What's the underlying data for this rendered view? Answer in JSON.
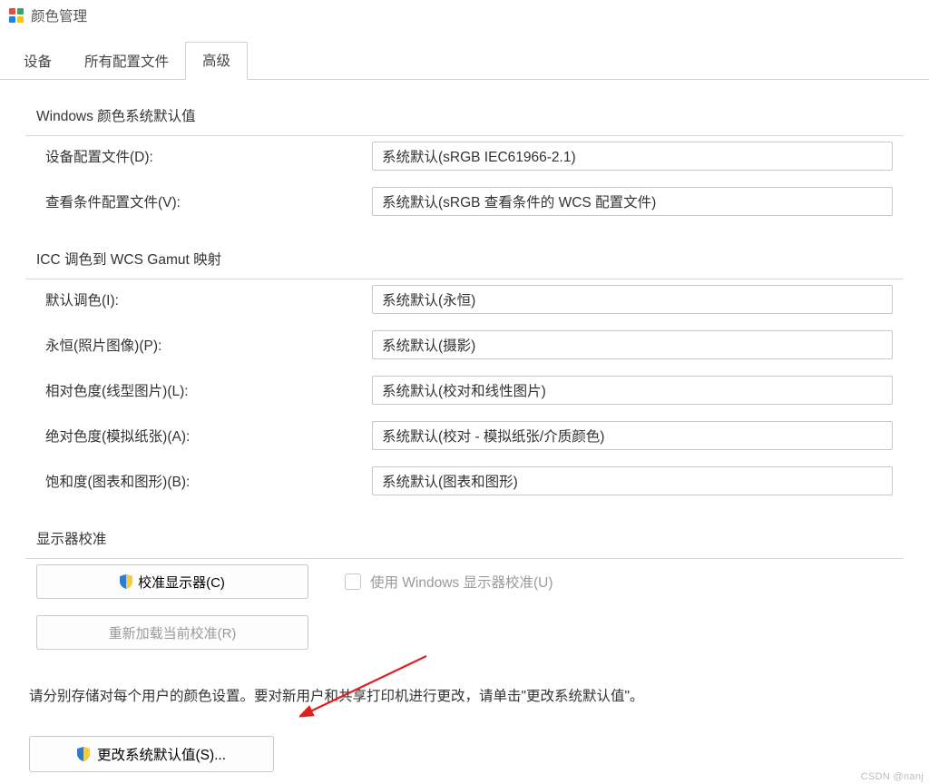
{
  "window": {
    "title": "颜色管理"
  },
  "tabs": {
    "device": "设备",
    "all_profiles": "所有配置文件",
    "advanced": "高级"
  },
  "group_defaults": {
    "legend": "Windows 颜色系统默认值",
    "device_profile_label": "设备配置文件(D):",
    "device_profile_value": "系统默认(sRGB IEC61966-2.1)",
    "viewing_label": "查看条件配置文件(V):",
    "viewing_value": "系统默认(sRGB 查看条件的 WCS 配置文件)"
  },
  "group_icc": {
    "legend": "ICC 调色到 WCS Gamut 映射",
    "default_render_label": "默认调色(I):",
    "default_render_value": "系统默认(永恒)",
    "perpetual_label": "永恒(照片图像)(P):",
    "perpetual_value": "系统默认(摄影)",
    "relative_label": "相对色度(线型图片)(L):",
    "relative_value": "系统默认(校对和线性图片)",
    "absolute_label": "绝对色度(模拟纸张)(A):",
    "absolute_value": "系统默认(校对 - 模拟纸张/介质颜色)",
    "saturation_label": "饱和度(图表和图形)(B):",
    "saturation_value": "系统默认(图表和图形)"
  },
  "group_calib": {
    "legend": "显示器校准",
    "calibrate_btn": "校准显示器(C)",
    "use_windows_calib": "使用 Windows 显示器校准(U)",
    "reload_btn": "重新加载当前校准(R)"
  },
  "bottom": {
    "text": "请分别存储对每个用户的颜色设置。要对新用户和共享打印机进行更改，请单击\"更改系统默认值\"。",
    "change_defaults_btn": "更改系统默认值(S)..."
  },
  "watermark": "CSDN @nanj"
}
